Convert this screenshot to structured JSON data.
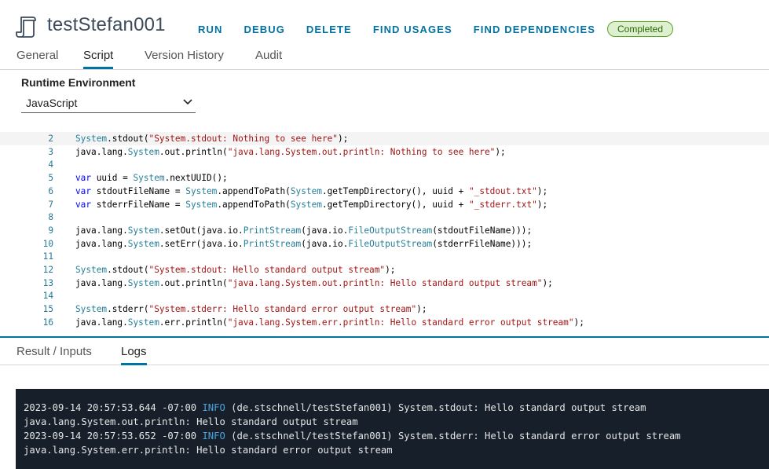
{
  "header": {
    "title": "testStefan001",
    "actions": [
      "RUN",
      "DEBUG",
      "DELETE",
      "FIND USAGES",
      "FIND DEPENDENCIES"
    ],
    "status": "Completed",
    "colors": {
      "accent": "#0072a3",
      "status_border": "#5aa220",
      "status_bg": "#dff0d0"
    }
  },
  "tabs": [
    "General",
    "Script",
    "Version History",
    "Audit"
  ],
  "active_tab": "Script",
  "runtime": {
    "label": "Runtime Environment",
    "selected": "JavaScript"
  },
  "code_lines": [
    {
      "n": "2",
      "tokens": [
        [
          "sy",
          "System"
        ],
        [
          "",
          "."
        ],
        [
          "",
          "stdout("
        ],
        [
          "st",
          "\"System.stdout: Nothing to see here\""
        ],
        [
          "",
          ");"
        ]
      ]
    },
    {
      "n": "3",
      "tokens": [
        [
          "",
          "java.lang."
        ],
        [
          "sy",
          "System"
        ],
        [
          "",
          ".out.println("
        ],
        [
          "st",
          "\"java.lang.System.out.println: Nothing to see here\""
        ],
        [
          "",
          ");"
        ]
      ]
    },
    {
      "n": "4",
      "tokens": []
    },
    {
      "n": "5",
      "tokens": [
        [
          "kw",
          "var"
        ],
        [
          "",
          " uuid = "
        ],
        [
          "sy",
          "System"
        ],
        [
          "",
          ".nextUUID();"
        ]
      ]
    },
    {
      "n": "6",
      "tokens": [
        [
          "kw",
          "var"
        ],
        [
          "",
          " stdoutFileName = "
        ],
        [
          "sy",
          "System"
        ],
        [
          "",
          ".appendToPath("
        ],
        [
          "sy",
          "System"
        ],
        [
          "",
          ".getTempDirectory(), uuid + "
        ],
        [
          "st",
          "\"_stdout.txt\""
        ],
        [
          "",
          ");"
        ]
      ]
    },
    {
      "n": "7",
      "tokens": [
        [
          "kw",
          "var"
        ],
        [
          "",
          " stderrFileName = "
        ],
        [
          "sy",
          "System"
        ],
        [
          "",
          ".appendToPath("
        ],
        [
          "sy",
          "System"
        ],
        [
          "",
          ".getTempDirectory(), uuid + "
        ],
        [
          "st",
          "\"_stderr.txt\""
        ],
        [
          "",
          ");"
        ]
      ]
    },
    {
      "n": "8",
      "tokens": []
    },
    {
      "n": "9",
      "tokens": [
        [
          "",
          "java.lang."
        ],
        [
          "sy",
          "System"
        ],
        [
          "",
          ".setOut(java.io."
        ],
        [
          "sy",
          "PrintStream"
        ],
        [
          "",
          "(java.io."
        ],
        [
          "sy",
          "FileOutputStream"
        ],
        [
          "",
          "(stdoutFileName)));"
        ]
      ]
    },
    {
      "n": "10",
      "tokens": [
        [
          "",
          "java.lang."
        ],
        [
          "sy",
          "System"
        ],
        [
          "",
          ".setErr(java.io."
        ],
        [
          "sy",
          "PrintStream"
        ],
        [
          "",
          "(java.io."
        ],
        [
          "sy",
          "FileOutputStream"
        ],
        [
          "",
          "(stderrFileName)));"
        ]
      ]
    },
    {
      "n": "11",
      "tokens": []
    },
    {
      "n": "12",
      "tokens": [
        [
          "sy",
          "System"
        ],
        [
          "",
          ".stdout("
        ],
        [
          "st",
          "\"System.stdout: Hello standard output stream\""
        ],
        [
          "",
          ");"
        ]
      ]
    },
    {
      "n": "13",
      "tokens": [
        [
          "",
          "java.lang."
        ],
        [
          "sy",
          "System"
        ],
        [
          "",
          ".out.println("
        ],
        [
          "st",
          "\"java.lang.System.out.println: Hello standard output stream\""
        ],
        [
          "",
          ");"
        ]
      ]
    },
    {
      "n": "14",
      "tokens": []
    },
    {
      "n": "15",
      "tokens": [
        [
          "sy",
          "System"
        ],
        [
          "",
          ".stderr("
        ],
        [
          "st",
          "\"System.stderr: Hello standard error output stream\""
        ],
        [
          "",
          ");"
        ]
      ]
    },
    {
      "n": "16",
      "tokens": [
        [
          "",
          "java.lang."
        ],
        [
          "sy",
          "System"
        ],
        [
          "",
          ".err.println("
        ],
        [
          "st",
          "\"java.lang.System.err.println: Hello standard error output stream\""
        ],
        [
          "",
          ");"
        ]
      ]
    }
  ],
  "result_tabs": [
    "Result / Inputs",
    "Logs"
  ],
  "active_result_tab": "Logs",
  "logs": [
    {
      "prefix": "2023-09-14 20:57:53.644 -07:00 ",
      "level": "INFO",
      "text": " (de.stschnell/testStefan001) System.stdout: Hello standard output stream"
    },
    {
      "prefix": "java.lang.System.out.println: Hello standard output stream",
      "level": "",
      "text": ""
    },
    {
      "prefix": "2023-09-14 20:57:53.652 -07:00 ",
      "level": "INFO",
      "text": " (de.stschnell/testStefan001) System.stderr: Hello standard error output stream"
    },
    {
      "prefix": "java.lang.System.err.println: Hello standard error output stream",
      "level": "",
      "text": ""
    }
  ]
}
